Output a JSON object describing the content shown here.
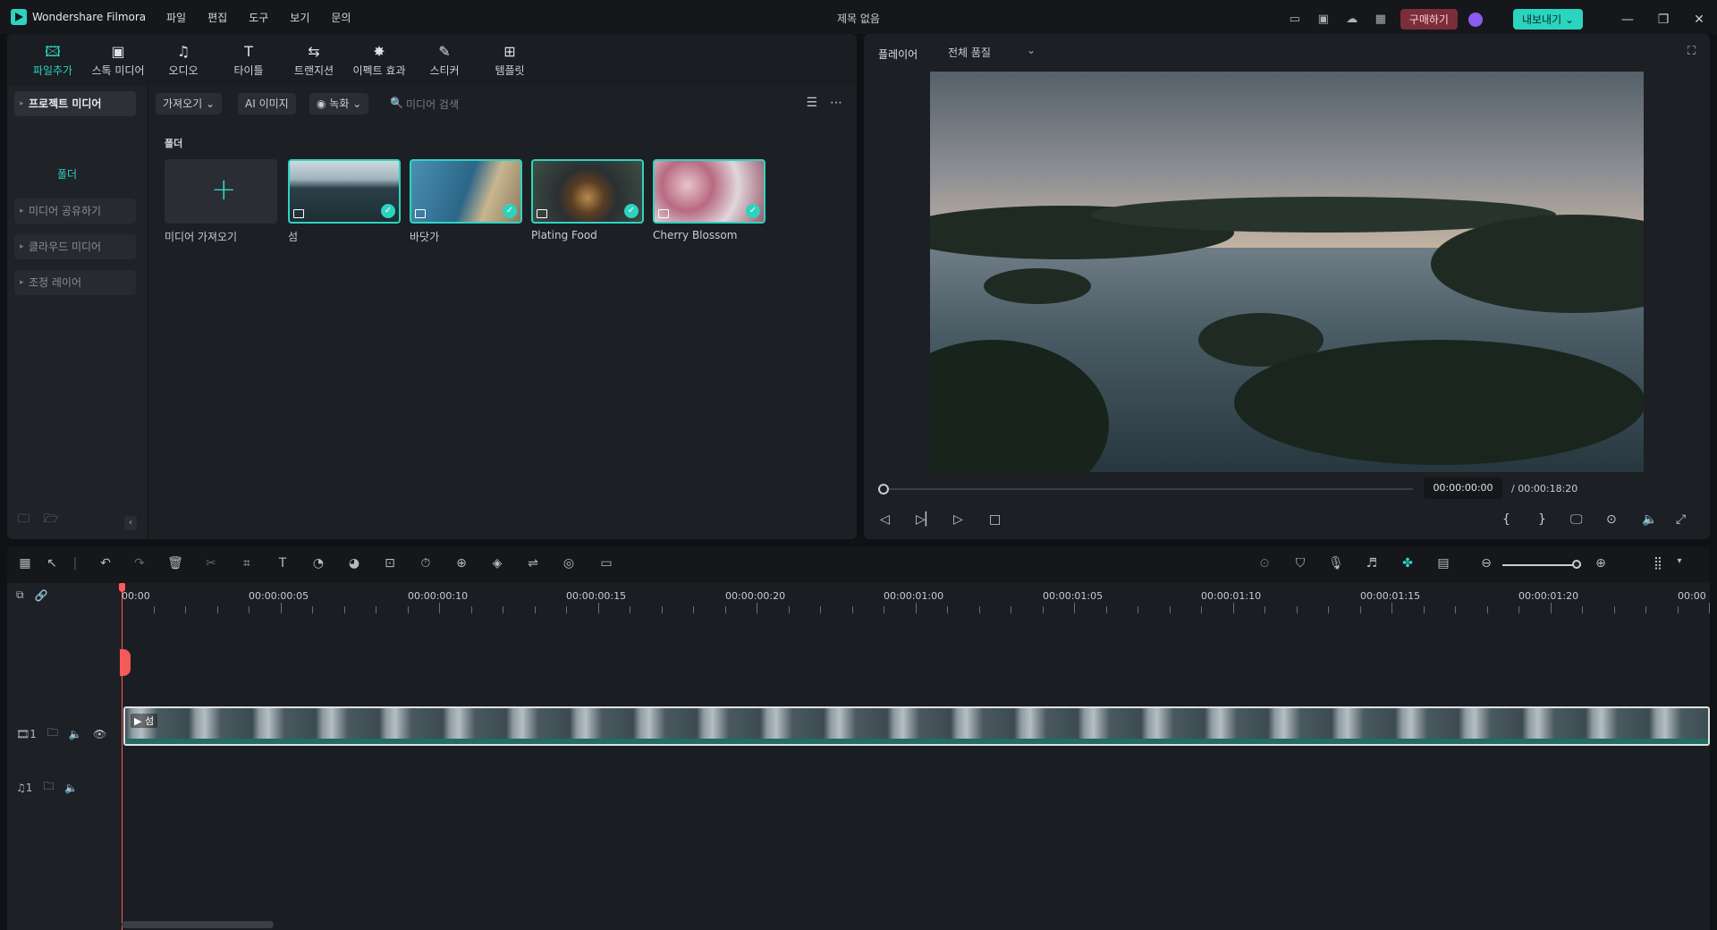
{
  "titlebar": {
    "app_name": "Wondershare Filmora",
    "menu": [
      "파일",
      "편집",
      "도구",
      "보기",
      "문의"
    ],
    "doc_title": "제목 없음",
    "buy_label": "구매하기",
    "export_label": "내보내기 ⌄"
  },
  "toolstrip": [
    {
      "label": "파일추가",
      "icon": "media-icon",
      "active": true
    },
    {
      "label": "스톡 미디어",
      "icon": "stock-media-icon"
    },
    {
      "label": "오디오",
      "icon": "audio-icon"
    },
    {
      "label": "타이틀",
      "icon": "title-icon"
    },
    {
      "label": "트랜지션",
      "icon": "transition-icon"
    },
    {
      "label": "이펙트 효과",
      "icon": "effects-icon"
    },
    {
      "label": "스티커",
      "icon": "sticker-icon"
    },
    {
      "label": "템플릿",
      "icon": "template-icon"
    }
  ],
  "sidebar": {
    "project_media": "프로젝트 미디어",
    "folder": "폴더",
    "items": [
      "미디어 공유하기",
      "클라우드 미디어",
      "조정 레이어"
    ]
  },
  "filterbar": {
    "import_label": "가져오기",
    "ai_label": "AI 이미지",
    "record_label": "녹화",
    "search_placeholder": "미디어 검색"
  },
  "media": {
    "folder_label": "폴더",
    "import_tile_label": "미디어 가져오기",
    "items": [
      {
        "name": "섬"
      },
      {
        "name": "바닷가"
      },
      {
        "name": "Plating Food"
      },
      {
        "name": "Cherry Blossom"
      }
    ]
  },
  "player": {
    "label": "플레이어",
    "quality": "전체 품질",
    "current_time": "00:00:00:00",
    "total_time": "/ 00:00:18:20"
  },
  "timeline": {
    "ruler": [
      "00:00",
      "00:00:00:05",
      "00:00:00:10",
      "00:00:00:15",
      "00:00:00:20",
      "00:00:01:00",
      "00:00:01:05",
      "00:00:01:10",
      "00:00:01:15",
      "00:00:01:20",
      "00:00"
    ],
    "video_track_label": "1",
    "audio_track_label": "1",
    "clip_label": "섬"
  },
  "colors": {
    "accent": "#2ed3c0",
    "buy": "#7b2d3a",
    "playhead": "#ff5b5b"
  }
}
